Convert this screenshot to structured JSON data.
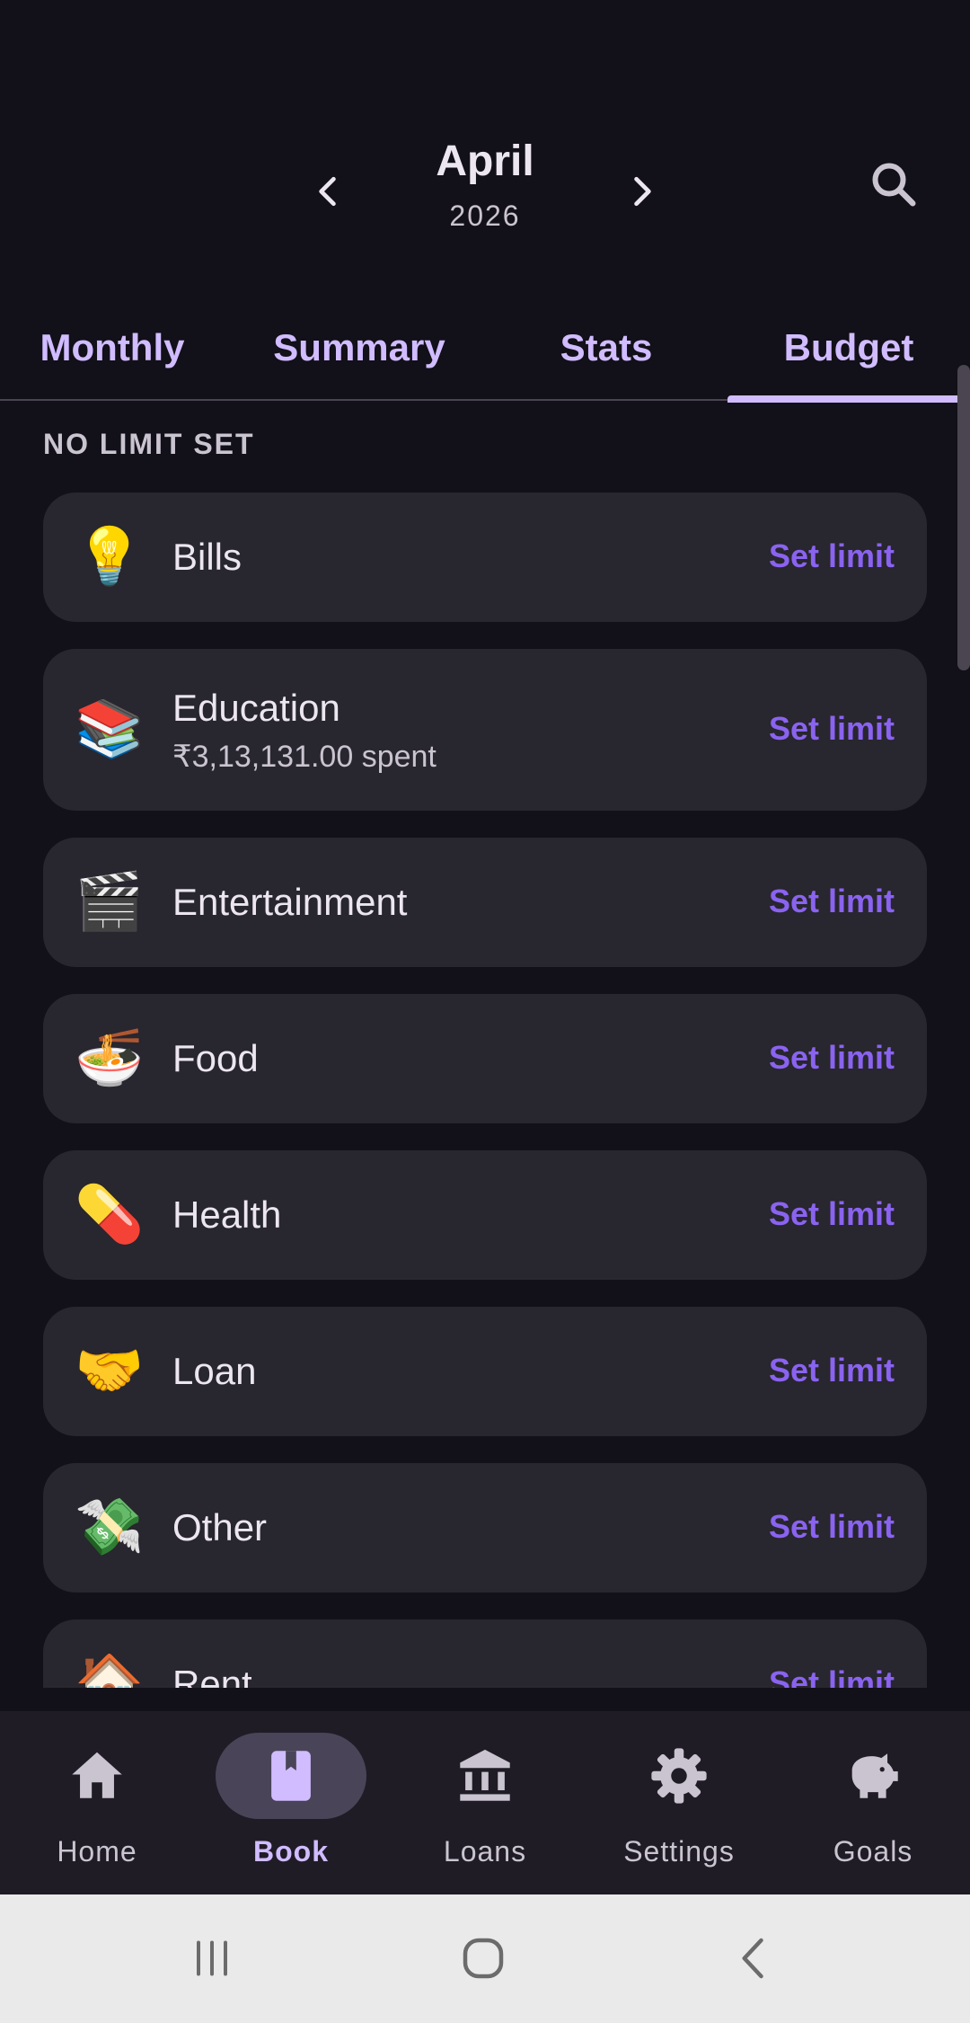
{
  "header": {
    "month": "April",
    "year": "2026"
  },
  "tabs": [
    {
      "label": "Monthly"
    },
    {
      "label": "Summary"
    },
    {
      "label": "Stats"
    },
    {
      "label": "Budget"
    }
  ],
  "active_tab": "Budget",
  "section_title": "NO LIMIT SET",
  "categories": [
    {
      "icon": "💡",
      "icon_name": "lightbulb-icon",
      "name": "Bills",
      "spent": "",
      "action": "Set limit"
    },
    {
      "icon": "📚",
      "icon_name": "books-icon",
      "name": "Education",
      "spent": "₹3,13,131.00 spent",
      "action": "Set limit"
    },
    {
      "icon": "🎬",
      "icon_name": "clapperboard-icon",
      "name": "Entertainment",
      "spent": "",
      "action": "Set limit"
    },
    {
      "icon": "🍜",
      "icon_name": "noodle-bowl-icon",
      "name": "Food",
      "spent": "",
      "action": "Set limit"
    },
    {
      "icon": "💊",
      "icon_name": "pill-icon",
      "name": "Health",
      "spent": "",
      "action": "Set limit"
    },
    {
      "icon": "🤝",
      "icon_name": "handshake-icon",
      "name": "Loan",
      "spent": "",
      "action": "Set limit"
    },
    {
      "icon": "💸",
      "icon_name": "money-wings-icon",
      "name": "Other",
      "spent": "",
      "action": "Set limit"
    },
    {
      "icon": "🏠",
      "icon_name": "house-icon",
      "name": "Rent",
      "spent": "",
      "action": "Set limit"
    }
  ],
  "bottom_nav": [
    {
      "label": "Home",
      "icon_name": "home-icon"
    },
    {
      "label": "Book",
      "icon_name": "book-icon"
    },
    {
      "label": "Loans",
      "icon_name": "bank-icon"
    },
    {
      "label": "Settings",
      "icon_name": "gear-icon"
    },
    {
      "label": "Goals",
      "icon_name": "piggy-bank-icon"
    }
  ],
  "active_nav": "Book",
  "colors": {
    "background": "#121018",
    "card": "#28262E",
    "accent": "#D0BCFF",
    "link": "#8A63F0"
  }
}
